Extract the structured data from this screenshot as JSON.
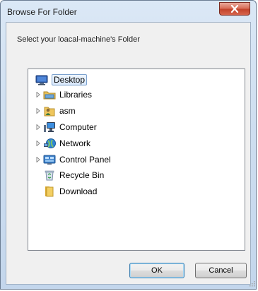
{
  "window": {
    "title": "Browse For Folder",
    "close_glyph": "X"
  },
  "dialog": {
    "description": "Select your loacal-machine's Folder"
  },
  "tree": {
    "items": [
      {
        "label": "Desktop",
        "icon": "desktop-icon",
        "expandable": false,
        "selected": true
      },
      {
        "label": "Libraries",
        "icon": "libraries-icon",
        "expandable": true,
        "selected": false
      },
      {
        "label": "asm",
        "icon": "user-folder-icon",
        "expandable": true,
        "selected": false
      },
      {
        "label": "Computer",
        "icon": "computer-icon",
        "expandable": true,
        "selected": false
      },
      {
        "label": "Network",
        "icon": "network-icon",
        "expandable": true,
        "selected": false
      },
      {
        "label": "Control Panel",
        "icon": "control-panel-icon",
        "expandable": true,
        "selected": false
      },
      {
        "label": "Recycle Bin",
        "icon": "recycle-bin-icon",
        "expandable": false,
        "selected": false
      },
      {
        "label": "Download",
        "icon": "folder-icon",
        "expandable": false,
        "selected": false
      }
    ]
  },
  "buttons": {
    "ok_label": "OK",
    "cancel_label": "Cancel"
  },
  "colors": {
    "titlebar": "#cfdff0",
    "close_button": "#c2432b",
    "selection_border": "#7da2ce",
    "dialog_background": "#f0f0f0"
  }
}
